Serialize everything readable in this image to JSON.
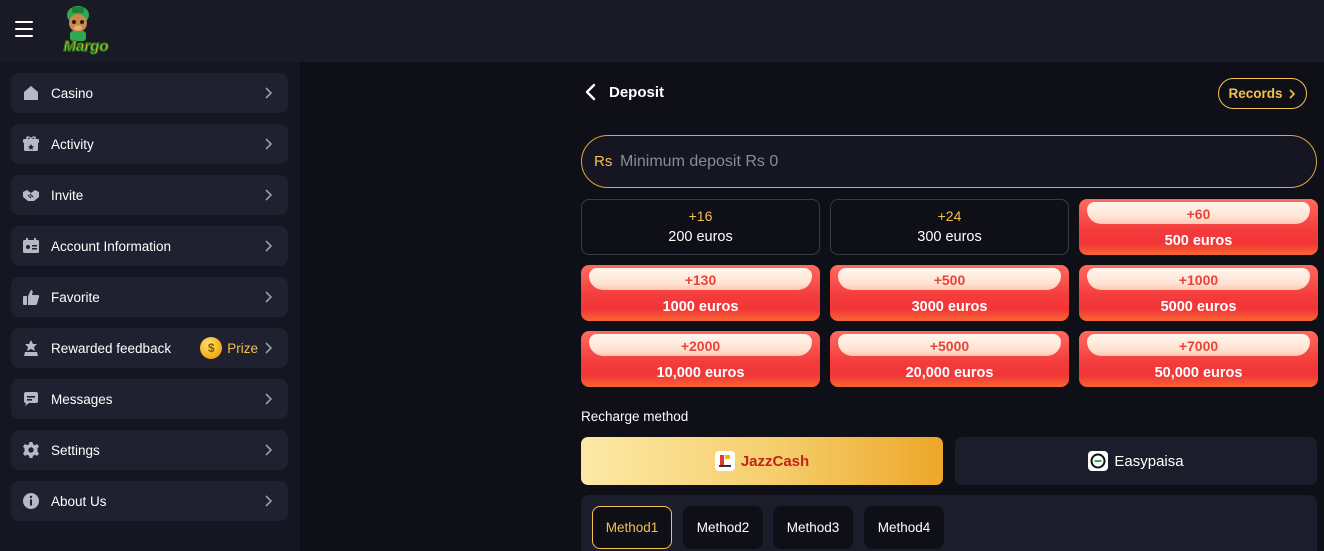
{
  "app": {
    "logo_text": "Margo",
    "menu_icon": "hamburger-menu-icon"
  },
  "sidebar": {
    "items": [
      {
        "label": "Casino",
        "icon": "house-icon"
      },
      {
        "label": "Activity",
        "icon": "gift-icon"
      },
      {
        "label": "Invite",
        "icon": "handshake-icon"
      },
      {
        "label": "Account Information",
        "icon": "id-card-icon"
      },
      {
        "label": "Favorite",
        "icon": "thumbs-up-icon"
      },
      {
        "label": "Rewarded feedback",
        "icon": "award-icon",
        "badge": "Prize"
      },
      {
        "label": "Messages",
        "icon": "chat-icon"
      },
      {
        "label": "Settings",
        "icon": "gear-icon"
      },
      {
        "label": "About Us",
        "icon": "info-icon"
      }
    ]
  },
  "header": {
    "title": "Deposit",
    "records_label": "Records"
  },
  "amount": {
    "currency": "Rs",
    "placeholder": "Minimum deposit Rs 0"
  },
  "options": [
    {
      "bonus": "+16",
      "amount": "200 euros",
      "style": "plain"
    },
    {
      "bonus": "+24",
      "amount": "300 euros",
      "style": "plain"
    },
    {
      "bonus": "+60",
      "amount": "500 euros",
      "style": "hot"
    },
    {
      "bonus": "+130",
      "amount": "1000 euros",
      "style": "hot"
    },
    {
      "bonus": "+500",
      "amount": "3000 euros",
      "style": "hot"
    },
    {
      "bonus": "+1000",
      "amount": "5000 euros",
      "style": "hot"
    },
    {
      "bonus": "+2000",
      "amount": "10,000 euros",
      "style": "hot"
    },
    {
      "bonus": "+5000",
      "amount": "20,000 euros",
      "style": "hot"
    },
    {
      "bonus": "+7000",
      "amount": "50,000 euros",
      "style": "hot"
    }
  ],
  "recharge": {
    "label": "Recharge method",
    "methods": [
      {
        "label": "JazzCash",
        "selected": true
      },
      {
        "label": "Easypaisa",
        "selected": false
      }
    ]
  },
  "channels": {
    "items": [
      "Method1",
      "Method2",
      "Method3",
      "Method4"
    ],
    "selected": "Method1"
  },
  "colors": {
    "accent_gold": "#f4c04e",
    "hot_red": "#f43c3c",
    "panel": "#1f2030",
    "background": "#0e0f17"
  }
}
